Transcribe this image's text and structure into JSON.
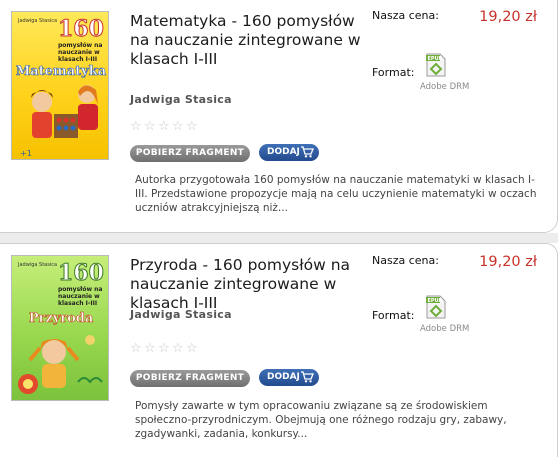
{
  "products": [
    {
      "cover": {
        "author": "Jadwiga Stasica",
        "number": "160",
        "subtitle": "pomysłów na nauczanie w klasach I-III",
        "title": "Matematyka"
      },
      "title": "Matematyka - 160 pomysłów na nauczanie zintegrowane w klasach I-III",
      "author": "Jadwiga Stasica",
      "rating": 0,
      "fragment_label": "POBIERZ FRAGMENT",
      "add_label": "DODAJ",
      "description": "Autorka przygotowała 160 pomysłów na nauczanie matematyki w klasach I-III. Przedstawione propozycje mają na celu uczynienie matematyki w oczach uczniów atrakcyjniejszą niż...",
      "price_label": "Nasza cena:",
      "price": "19,20 zł",
      "format_label": "Format:",
      "format_badge": "EPUB",
      "drm": "Adobe DRM"
    },
    {
      "cover": {
        "author": "Jadwiga Stasica",
        "number": "160",
        "subtitle": "pomysłów na nauczanie w klasach I-III",
        "title": "Przyroda"
      },
      "title": "Przyroda - 160 pomysłów na nauczanie zintegrowane w klasach I-III",
      "author": "Jadwiga Stasica",
      "rating": 0,
      "fragment_label": "POBIERZ FRAGMENT",
      "add_label": "DODAJ",
      "description": "Pomysły zawarte w tym opracowaniu związane są ze środowiskiem społeczno-przyrodniczym. Obejmują one różnego rodzaju gry, zabawy, zgadywanki, zadania, konkursy...",
      "price_label": "Nasza cena:",
      "price": "19,20 zł",
      "format_label": "Format:",
      "format_badge": "EPUB",
      "drm": "Adobe DRM"
    }
  ],
  "colors": {
    "price": "#c8322a",
    "add_button": "#2f5ea3",
    "fragment_button": "#808080"
  },
  "icons": {
    "cart": "cart-icon",
    "star": "star-icon",
    "epub": "epub-file-icon"
  }
}
